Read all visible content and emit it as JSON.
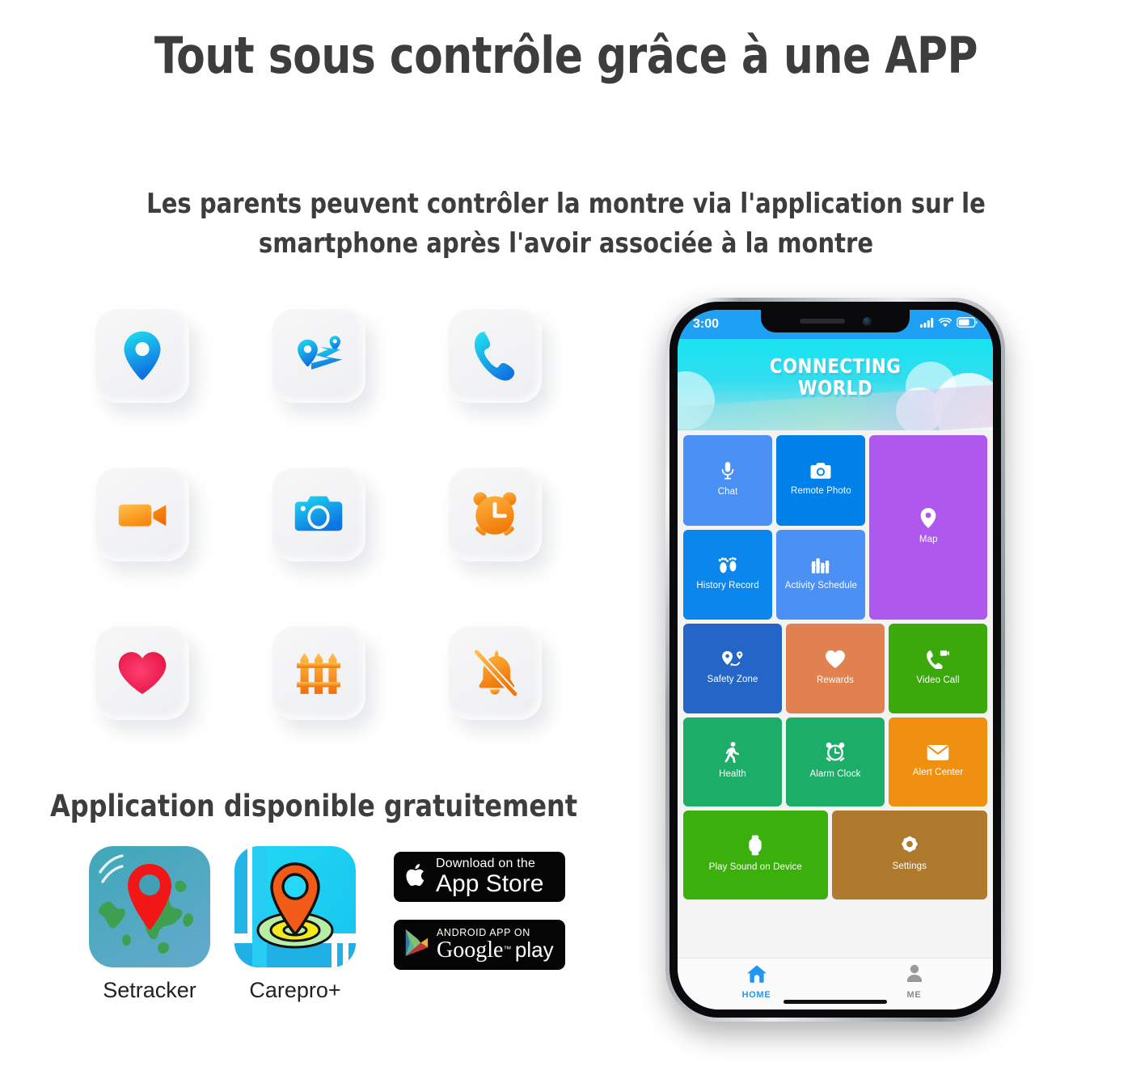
{
  "headline": "Tout sous contrôle grâce à une APP",
  "subhead": "Les parents peuvent contrôler la montre via l'application sur le smartphone après l'avoir associée à la montre",
  "availability_title": "Application disponible gratuitement",
  "feature_icons": [
    {
      "name": "location-pin-icon",
      "label": "location-pin"
    },
    {
      "name": "route-map-icon",
      "label": "route-map"
    },
    {
      "name": "phone-call-icon",
      "label": "phone-call"
    },
    {
      "name": "video-camera-icon",
      "label": "video-camera"
    },
    {
      "name": "camera-icon",
      "label": "camera"
    },
    {
      "name": "alarm-clock-icon",
      "label": "alarm-clock"
    },
    {
      "name": "heart-icon",
      "label": "heart"
    },
    {
      "name": "fence-icon",
      "label": "fence"
    },
    {
      "name": "bell-off-icon",
      "label": "bell-off"
    }
  ],
  "app_icons": [
    {
      "label": "Setracker",
      "icon": "setracker-app-icon"
    },
    {
      "label": "Carepro+",
      "icon": "carepro-app-icon"
    }
  ],
  "badges": {
    "apple": {
      "top": "Download on the",
      "main": "App Store",
      "icon": "apple-logo-icon"
    },
    "google": {
      "top": "ANDROID APP ON",
      "main_a": "Google",
      "main_b": "play",
      "icon": "google-play-icon"
    }
  },
  "phone": {
    "status_bar": {
      "time": "3:00",
      "icons": [
        "cellular-signal-icon",
        "wifi-icon",
        "battery-icon"
      ],
      "background": "#1EA0F5"
    },
    "banner": {
      "line1": "CONNECTING",
      "line2": "WORLD"
    },
    "tiles": [
      {
        "label": "Chat",
        "icon": "microphone-icon",
        "color": "#4A90F5",
        "span": 1
      },
      {
        "label": "Remote Photo",
        "icon": "camera-icon",
        "color": "#0080E8",
        "span": 1
      },
      {
        "label": "Map",
        "icon": "map-pin-icon",
        "color": "#AE58EE",
        "span": 2
      },
      {
        "label": "History Record",
        "icon": "footprints-icon",
        "color": "#0A86EC",
        "span": 1
      },
      {
        "label": "Activity Schedule",
        "icon": "activity-books-icon",
        "color": "#4A90F5",
        "span": 1
      },
      {
        "label": "Safety Zone",
        "icon": "geofence-pin-icon",
        "color": "#2466C8",
        "span": 1
      },
      {
        "label": "Rewards",
        "icon": "heart-icon",
        "color": "#E0814F",
        "span": 1
      },
      {
        "label": "Video Call",
        "icon": "video-call-icon",
        "color": "#3BA80C",
        "span": 1
      },
      {
        "label": "Health",
        "icon": "walking-person-icon",
        "color": "#1CAD68",
        "span": 1
      },
      {
        "label": "Alarm Clock",
        "icon": "alarm-clock-icon",
        "color": "#1CAD68",
        "span": 1
      },
      {
        "label": "Alert Center",
        "icon": "envelope-icon",
        "color": "#F09011",
        "span": 1
      },
      {
        "label": "Play Sound on Device",
        "icon": "smartwatch-icon",
        "color": "#3BB00C",
        "span": 1
      },
      {
        "label": "Settings",
        "icon": "gear-icon",
        "color": "#B07A2E",
        "span": 1
      }
    ],
    "tabs": [
      {
        "label": "HOME",
        "icon": "home-icon",
        "active": true
      },
      {
        "label": "ME",
        "icon": "person-icon",
        "active": false
      }
    ]
  }
}
